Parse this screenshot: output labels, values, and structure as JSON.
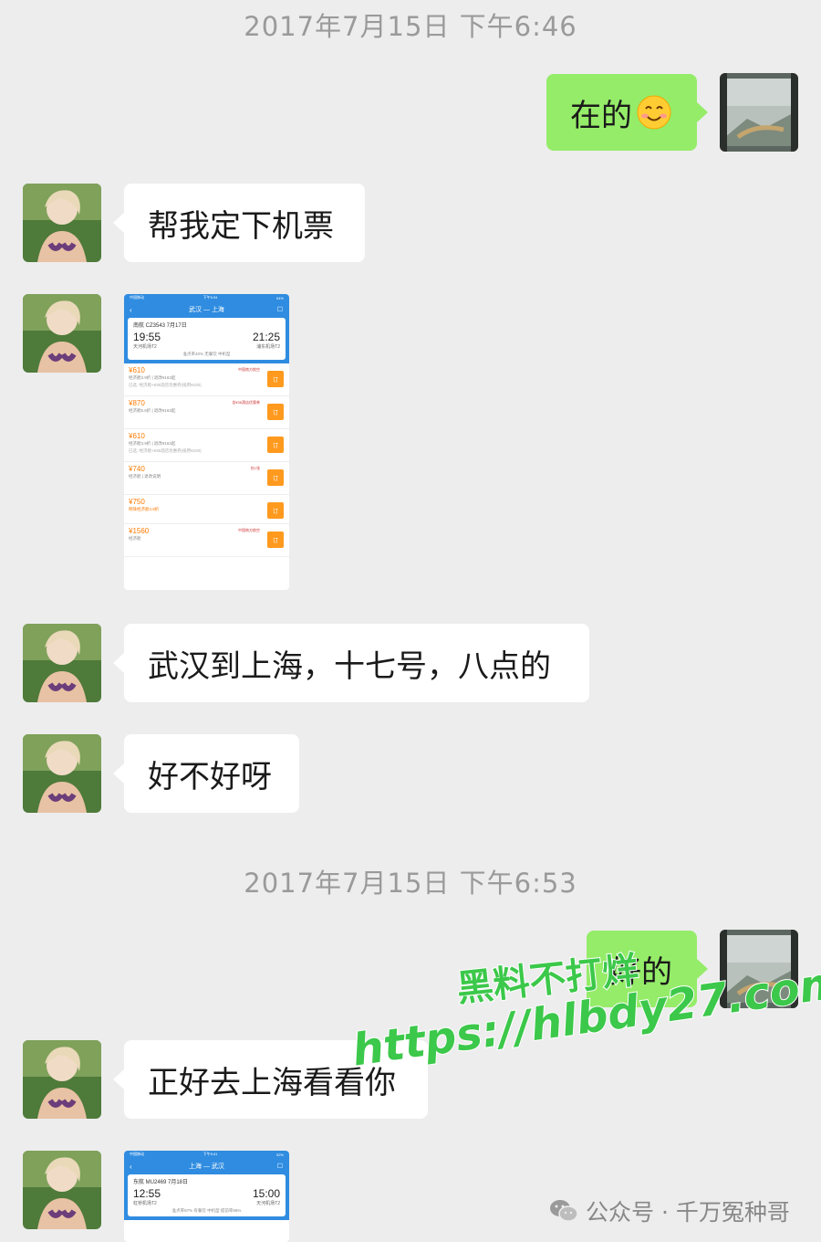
{
  "timestamps": [
    "2017年7月15日 下午6:46",
    "2017年7月15日 下午6:53"
  ],
  "messages": {
    "m1": "在的",
    "m2": "帮我定下机票",
    "m3": "武汉到上海，十七号，八点的",
    "m4": "好不好呀",
    "m5": "好的",
    "m6": "正好去上海看看你"
  },
  "shot1": {
    "status_left": "中国移动",
    "status_mid": "下午5:34",
    "status_right": "54%",
    "route": "武汉 — 上海",
    "flight": "南航 CZ3543  7月17日",
    "dep_time": "19:55",
    "arr_time": "21:25",
    "dep_airport": "天河机场T2",
    "arr_airport": "浦东机场T2",
    "meta": "准点率40%  无餐饮  中机型",
    "fares": [
      {
        "price": "¥610",
        "cls": "经济舱3.9折 | 退改¥163起",
        "extra": "已选: 经济舱+¥36酒店优惠券(抵用¥100)",
        "book": "订",
        "tag": "中国南方航空"
      },
      {
        "price": "¥870",
        "cls": "经济舱5.6折 | 退改¥163起",
        "extra": "",
        "book": "订",
        "tag": "含¥36酒店优惠券"
      },
      {
        "price": "¥610",
        "cls": "经济舱3.9折 | 退改¥163起",
        "extra": "已选: 经济舱+¥36酒店优惠券(抵用¥100)",
        "book": "订",
        "tag": ""
      },
      {
        "price": "¥740",
        "cls": "经济舱 | 退改说明",
        "extra": "",
        "book": "订",
        "tag": "仅1张"
      },
      {
        "price": "¥750",
        "cls": "明珠经济舱4.8折",
        "extra": "",
        "book": "订",
        "tag": ""
      },
      {
        "price": "¥1560",
        "cls": "经济舱",
        "extra": "",
        "book": "订",
        "tag": "中国南方航空"
      }
    ]
  },
  "shot2": {
    "status_left": "中国移动",
    "status_mid": "下午5:41",
    "status_right": "52%",
    "route": "上海 — 武汉",
    "flight": "东航 MU2469  7月18日",
    "dep_time": "12:55",
    "arr_time": "15:00",
    "dep_airport": "虹桥机场T2",
    "arr_airport": "天河机场T2",
    "meta": "准点率87%  有餐饮  中机型  提前率86%"
  },
  "watermark": {
    "line1": "黑料不打烊",
    "line2": "https://hlbdy27.com"
  },
  "brand": {
    "text": "公众号 · 千万冤种哥"
  },
  "icons": [
    "smile-emoji-icon",
    "wechat-icon"
  ],
  "colors": {
    "background": "#ededed",
    "bubble_self": "#95ec69",
    "bubble_other": "#ffffff",
    "watermark": "#3cc84a"
  }
}
